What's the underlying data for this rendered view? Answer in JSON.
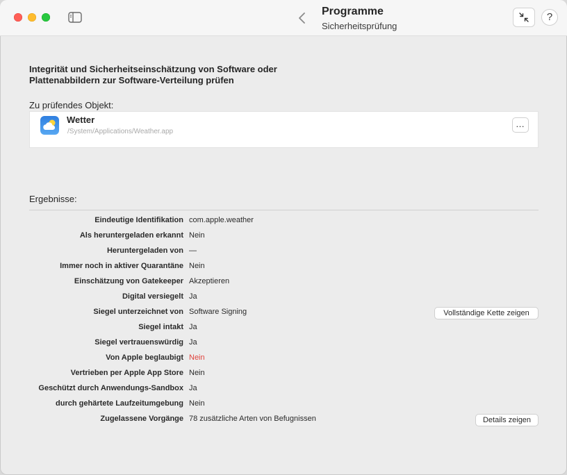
{
  "titlebar": {
    "title": "Programme",
    "subtitle": "Sicherheitsprüfung",
    "help_label": "?"
  },
  "main": {
    "heading": "Integrität und Sicherheitseinschätzung von Software oder Plattenabbildern zur Software-Verteilung prüfen",
    "object_label": "Zu prüfendes Objekt:",
    "object": {
      "name": "Wetter",
      "path": "/System/Applications/Weather.app",
      "more_label": "…"
    },
    "results_label": "Ergebnisse:",
    "results": [
      {
        "label": "Eindeutige Identifikation",
        "value": "com.apple.weather"
      },
      {
        "label": "Als heruntergeladen erkannt",
        "value": "Nein"
      },
      {
        "label": "Heruntergeladen von",
        "value": "—"
      },
      {
        "label": "Immer noch in aktiver Quarantäne",
        "value": "Nein"
      },
      {
        "label": "Einschätzung von Gatekeeper",
        "value": "Akzeptieren"
      },
      {
        "label": "Digital versiegelt",
        "value": "Ja"
      },
      {
        "label": "Siegel unterzeichnet von",
        "value": "Software Signing",
        "button": "Vollständige Kette zeigen"
      },
      {
        "label": "Siegel intakt",
        "value": "Ja"
      },
      {
        "label": "Siegel vertrauenswürdig",
        "value": "Ja"
      },
      {
        "label": "Von Apple beglaubigt",
        "value": "Nein",
        "alert": true
      },
      {
        "label": "Vertrieben per Apple App Store",
        "value": "Nein"
      },
      {
        "label": "Geschützt durch Anwendungs-Sandbox",
        "value": "Ja"
      },
      {
        "label": "durch gehärtete Laufzeitumgebung",
        "value": "Nein"
      },
      {
        "label": "Zugelassene Vorgänge",
        "value": "78 zusätzliche Arten von Befugnissen",
        "button": "Details zeigen"
      }
    ]
  },
  "colors": {
    "alert": "#e0443e",
    "close": "#ff5f57",
    "minimize": "#febc2e",
    "maximize": "#28c840"
  }
}
